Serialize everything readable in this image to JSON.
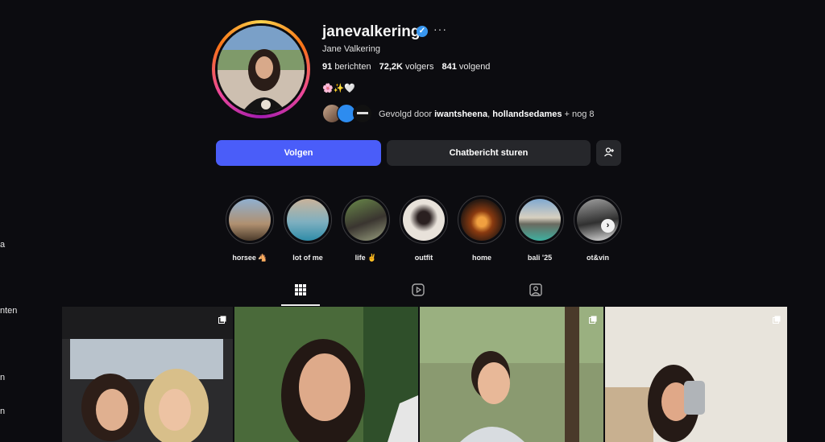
{
  "sidebar": {
    "fragments": [
      "a",
      "nten",
      "n",
      "n"
    ]
  },
  "profile": {
    "username": "janevalkering",
    "verified_mark": "✓",
    "more_label": "···",
    "full_name": "Jane Valkering",
    "stats": {
      "posts_value": "91",
      "posts_label": "berichten",
      "followers_value": "72,2K",
      "followers_label": "volgers",
      "following_value": "841",
      "following_label": "volgend"
    },
    "bio": "🌸✨🤍",
    "followed_by": {
      "prefix": "Gevolgd door ",
      "user1": "iwantsheena",
      "separator": ", ",
      "user2": "hollandsedames",
      "suffix": " + nog 8"
    }
  },
  "actions": {
    "follow_label": "Volgen",
    "message_label": "Chatbericht sturen",
    "add_user_icon": "person-add-icon"
  },
  "highlights": [
    {
      "label": "horsee 🐴"
    },
    {
      "label": "lot of me"
    },
    {
      "label": "life ✌️"
    },
    {
      "label": "outfit"
    },
    {
      "label": "home"
    },
    {
      "label": "bali '25"
    },
    {
      "label": "ot&vin"
    }
  ],
  "tabs": [
    {
      "name": "posts",
      "icon": "grid-icon",
      "active": true
    },
    {
      "name": "reels",
      "icon": "reels-icon",
      "active": false
    },
    {
      "name": "tagged",
      "icon": "tagged-icon",
      "active": false
    }
  ],
  "colors": {
    "follow_button": "#4a5df9",
    "secondary_button": "#26272b",
    "background": "#0c0c10",
    "verified": "#3897f0"
  }
}
